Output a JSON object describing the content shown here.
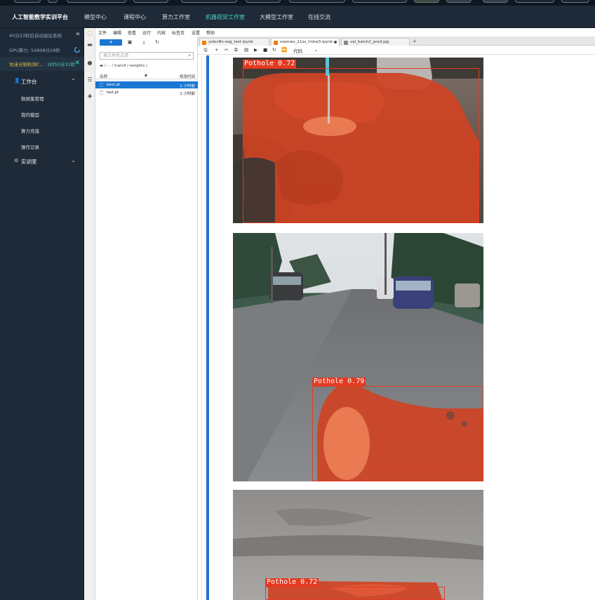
{
  "topnav": {
    "brand": "人工智能教学实训平台",
    "items": [
      "模型中心",
      "课程中心",
      "算力工作室",
      "机器视觉工作室",
      "大模型工作室",
      "在线交流"
    ],
    "active_index": 3
  },
  "sidebar": {
    "timer_text": "40分23秒后自动退出系统",
    "gpu_text": "GPU算力: 54808分28秒",
    "task_name": "坑洼分割检测C...",
    "task_time": "1时55分31秒",
    "menu": [
      {
        "label": "工作台",
        "expanded": true
      },
      {
        "label": "实训室",
        "expanded": false
      }
    ],
    "sub_items": [
      "数据集管理",
      "我的模型",
      "算力充值",
      "操作记录"
    ]
  },
  "jupyter": {
    "menubar": [
      "文件",
      "编辑",
      "查看",
      "运行",
      "内核",
      "标签页",
      "设置",
      "帮助"
    ],
    "filebrowser": {
      "new_label": "+",
      "search_placeholder": "按文件名过滤",
      "breadcrumb": "/ ··· / train4 / weights /",
      "col_name": "名称",
      "col_modified": "修改时间",
      "files": [
        {
          "name": "best.pt",
          "modified": "1 小时前",
          "selected": true
        },
        {
          "name": "last.pt",
          "modified": "1 小时前",
          "selected": false
        }
      ]
    },
    "tabs": [
      {
        "label": "yolov8n-seg_test.ipynb",
        "active": false
      },
      {
        "label": "xiamiao_11ss_lmkw3.ipynb",
        "active": true
      },
      {
        "label": "val_batch2_pred.jpg",
        "active": false
      }
    ],
    "cell_type": "代码"
  },
  "detections": [
    {
      "label": "Pothole 0.72"
    },
    {
      "label": "Pothole 0.79"
    },
    {
      "label": "Pothole 0.72"
    }
  ],
  "colors": {
    "accent": "#4fd1c5",
    "mask": "#e23b22",
    "jupyter_blue": "#1976d2",
    "task_yellow": "#e3c44e"
  }
}
